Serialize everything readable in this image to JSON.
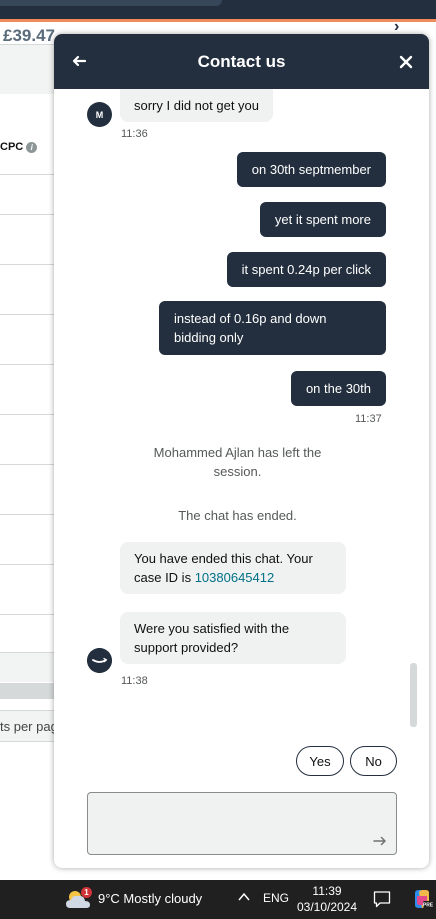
{
  "background_page": {
    "budget_text": "£39.47",
    "column_header": "CPC",
    "per_page_text": "ts per page"
  },
  "chat": {
    "title": "Contact us",
    "agent_avatar_initial": "M",
    "messages": {
      "m1": "sorry I did not get you",
      "t1": "11:36",
      "m2": "on 30th septmember",
      "m3": "yet it spent more",
      "m4": "it spent 0.24p per click",
      "m5": "instead of 0.16p and down bidding only",
      "m6": "on the 30th",
      "t2": "11:37",
      "sys1": "Mohammed Ajlan has left the session.",
      "sys2": "The chat has ended.",
      "m7_prefix": "You have ended this chat. Your case ID is ",
      "case_id": "10380645412",
      "m8": "Were you satisfied with the support provided?",
      "t3": "11:38"
    },
    "buttons": {
      "yes": "Yes",
      "no": "No"
    },
    "input": {
      "value": "",
      "placeholder": ""
    }
  },
  "taskbar": {
    "weather_badge": "1",
    "weather": "9°C  Mostly cloudy",
    "language": "ENG",
    "time": "11:39",
    "date": "03/10/2024"
  },
  "colors": {
    "header_bg": "#232f3e",
    "outgoing_bubble": "#232f3e",
    "incoming_bubble": "#f0f2f2",
    "link": "#007185",
    "accent_line": "#f08b5b",
    "taskbar_bg": "#202020"
  },
  "icons": [
    "back-arrow-icon",
    "close-icon",
    "info-icon",
    "amazon-smile-icon",
    "send-arrow-icon",
    "weather-cloud-icon",
    "chevron-up-icon",
    "notification-icon",
    "copilot-icon"
  ]
}
